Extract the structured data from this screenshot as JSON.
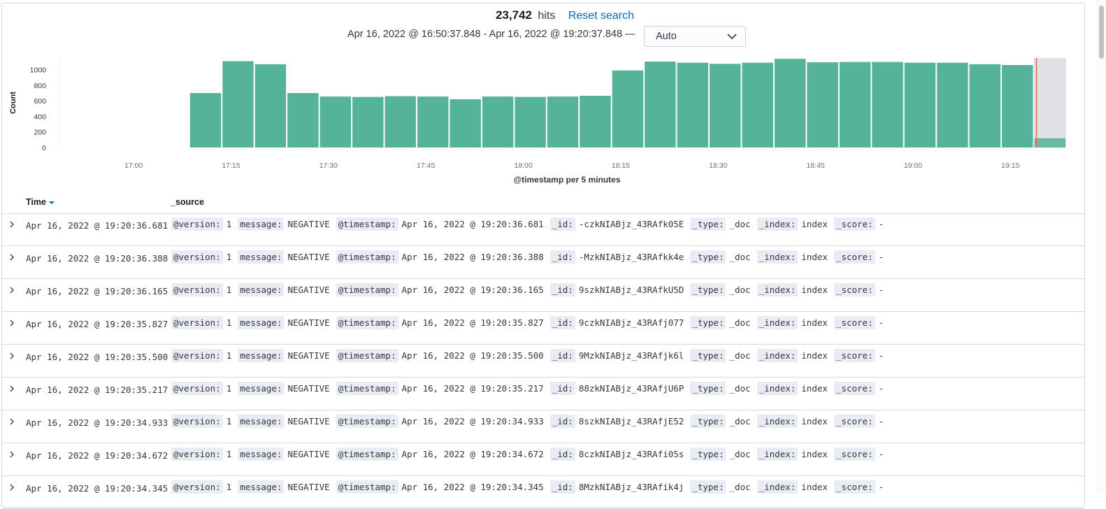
{
  "header": {
    "hits_count": "23,742",
    "hits_word": "hits",
    "reset_label": "Reset search",
    "time_range": "Apr 16, 2022 @ 16:50:37.848 - Apr 16, 2022 @ 19:20:37.848 —",
    "interval": "Auto"
  },
  "chart_data": {
    "type": "bar",
    "ylabel": "Count",
    "xlabel": "@timestamp per 5 minutes",
    "ylim": [
      0,
      1150
    ],
    "yticks": [
      0,
      200,
      400,
      600,
      800,
      1000
    ],
    "xticks": [
      "17:00",
      "17:15",
      "17:30",
      "17:45",
      "18:00",
      "18:15",
      "18:30",
      "18:45",
      "19:00",
      "19:15"
    ],
    "categories": [
      "16:50",
      "16:55",
      "17:00",
      "17:05",
      "17:10",
      "17:15",
      "17:20",
      "17:25",
      "17:30",
      "17:35",
      "17:40",
      "17:45",
      "17:50",
      "17:55",
      "18:00",
      "18:05",
      "18:10",
      "18:15",
      "18:20",
      "18:25",
      "18:30",
      "18:35",
      "18:40",
      "18:45",
      "18:50",
      "18:55",
      "19:00",
      "19:05",
      "19:10",
      "19:15",
      "19:20"
    ],
    "values": [
      0,
      0,
      0,
      0,
      700,
      1110,
      1070,
      700,
      655,
      650,
      660,
      655,
      620,
      655,
      650,
      655,
      665,
      990,
      1105,
      1090,
      1075,
      1090,
      1140,
      1095,
      1100,
      1100,
      1090,
      1090,
      1070,
      1060,
      120
    ],
    "bar_color": "#54b399",
    "now_marker_color": "#e7664c",
    "partial_bucket_color": "#e0e2e6",
    "grid": false
  },
  "table": {
    "col_time": "Time",
    "col_source": "_source",
    "field_labels": {
      "version": "@version:",
      "message": "message:",
      "timestamp": "@timestamp:",
      "id": "_id:",
      "type": "_type:",
      "index": "_index:",
      "score": "_score:"
    },
    "rows": [
      {
        "time": "Apr 16, 2022 @ 19:20:36.681",
        "version": "1",
        "message": "NEGATIVE",
        "timestamp": "Apr 16, 2022 @ 19:20:36.681",
        "id": "-czkNIABjz_43RAfk05E",
        "type": "_doc",
        "index": "index",
        "score": "-"
      },
      {
        "time": "Apr 16, 2022 @ 19:20:36.388",
        "version": "1",
        "message": "NEGATIVE",
        "timestamp": "Apr 16, 2022 @ 19:20:36.388",
        "id": "-MzkNIABjz_43RAfkk4e",
        "type": "_doc",
        "index": "index",
        "score": "-"
      },
      {
        "time": "Apr 16, 2022 @ 19:20:36.165",
        "version": "1",
        "message": "NEGATIVE",
        "timestamp": "Apr 16, 2022 @ 19:20:36.165",
        "id": "9szkNIABjz_43RAfkU5D",
        "type": "_doc",
        "index": "index",
        "score": "-"
      },
      {
        "time": "Apr 16, 2022 @ 19:20:35.827",
        "version": "1",
        "message": "NEGATIVE",
        "timestamp": "Apr 16, 2022 @ 19:20:35.827",
        "id": "9czkNIABjz_43RAfj077",
        "type": "_doc",
        "index": "index",
        "score": "-"
      },
      {
        "time": "Apr 16, 2022 @ 19:20:35.500",
        "version": "1",
        "message": "NEGATIVE",
        "timestamp": "Apr 16, 2022 @ 19:20:35.500",
        "id": "9MzkNIABjz_43RAfjk6l",
        "type": "_doc",
        "index": "index",
        "score": "-"
      },
      {
        "time": "Apr 16, 2022 @ 19:20:35.217",
        "version": "1",
        "message": "NEGATIVE",
        "timestamp": "Apr 16, 2022 @ 19:20:35.217",
        "id": "88zkNIABjz_43RAfjU6P",
        "type": "_doc",
        "index": "index",
        "score": "-"
      },
      {
        "time": "Apr 16, 2022 @ 19:20:34.933",
        "version": "1",
        "message": "NEGATIVE",
        "timestamp": "Apr 16, 2022 @ 19:20:34.933",
        "id": "8szkNIABjz_43RAfjE52",
        "type": "_doc",
        "index": "index",
        "score": "-"
      },
      {
        "time": "Apr 16, 2022 @ 19:20:34.672",
        "version": "1",
        "message": "NEGATIVE",
        "timestamp": "Apr 16, 2022 @ 19:20:34.672",
        "id": "8czkNIABjz_43RAfi05s",
        "type": "_doc",
        "index": "index",
        "score": "-"
      },
      {
        "time": "Apr 16, 2022 @ 19:20:34.345",
        "version": "1",
        "message": "NEGATIVE",
        "timestamp": "Apr 16, 2022 @ 19:20:34.345",
        "id": "8MzkNIABjz_43RAfik4j",
        "type": "_doc",
        "index": "index",
        "score": "-"
      }
    ]
  }
}
